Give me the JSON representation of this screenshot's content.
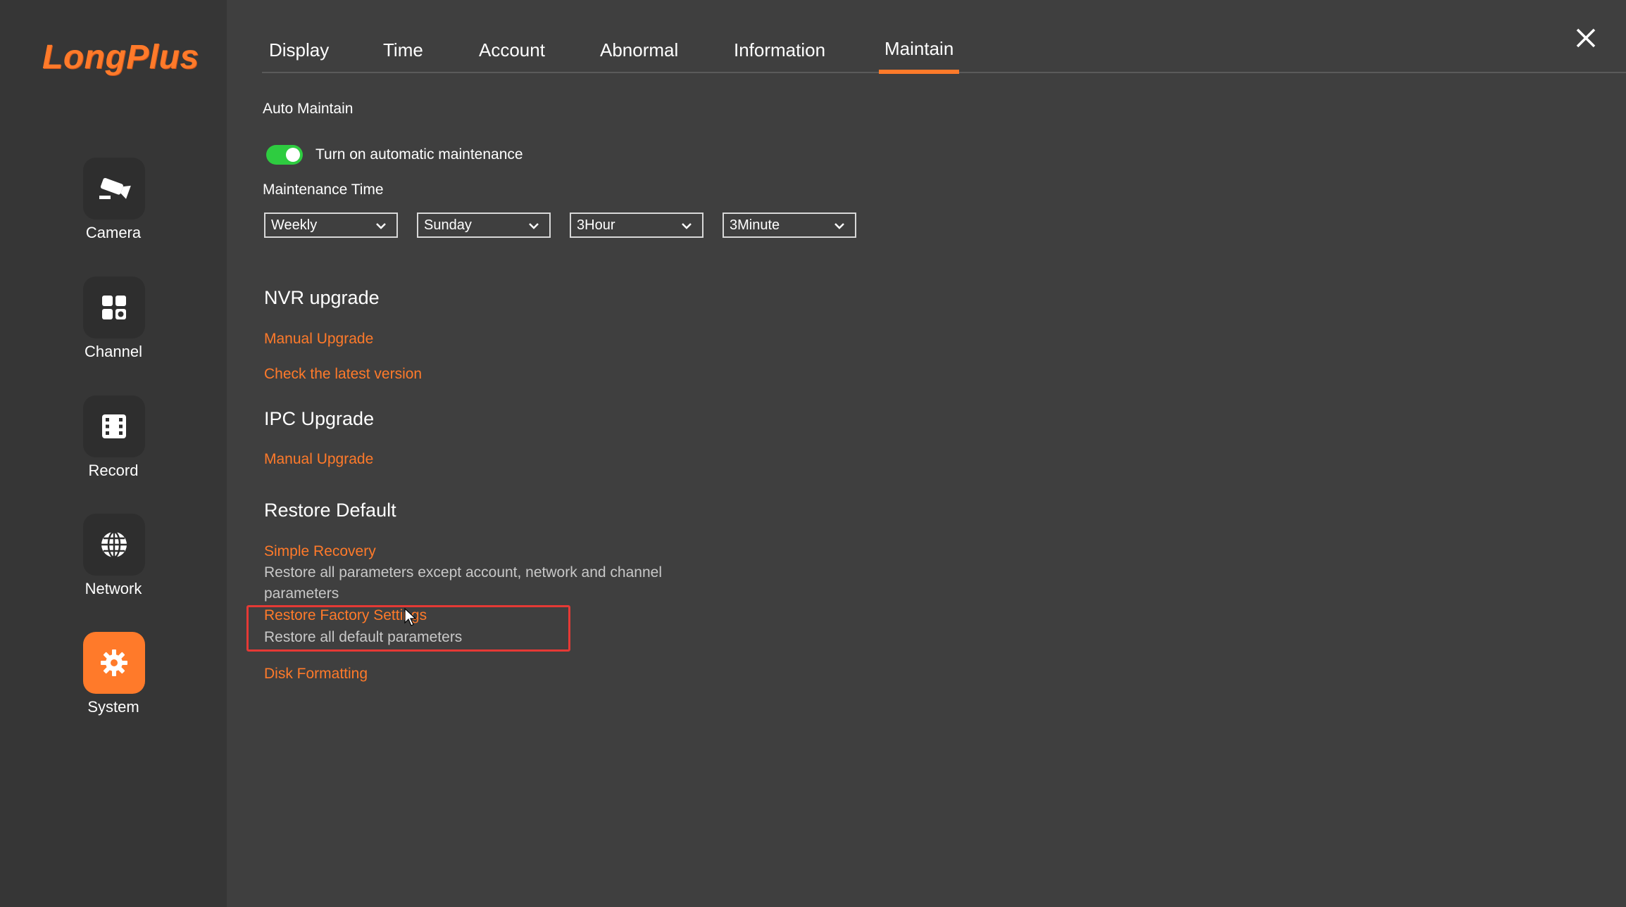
{
  "brand": {
    "name": "LongPlus",
    "color": "#ff7a2a"
  },
  "sidebar": {
    "items": [
      {
        "label": "Camera",
        "icon": "camera-icon",
        "active": false
      },
      {
        "label": "Channel",
        "icon": "channel-grid-icon",
        "active": false
      },
      {
        "label": "Record",
        "icon": "record-film-icon",
        "active": false
      },
      {
        "label": "Network",
        "icon": "globe-icon",
        "active": false
      },
      {
        "label": "System",
        "icon": "gear-icon",
        "active": true
      }
    ]
  },
  "tabs": [
    {
      "label": "Display"
    },
    {
      "label": "Time"
    },
    {
      "label": "Account"
    },
    {
      "label": "Abnormal"
    },
    {
      "label": "Information"
    },
    {
      "label": "Maintain",
      "active": true
    }
  ],
  "auto_maintain": {
    "heading": "Auto Maintain",
    "toggle_label": "Turn on automatic maintenance",
    "toggle_on": true,
    "time_label": "Maintenance Time",
    "selects": [
      {
        "value": "Weekly"
      },
      {
        "value": "Sunday"
      },
      {
        "value": "3Hour"
      },
      {
        "value": "3Minute"
      }
    ]
  },
  "nvr_upgrade": {
    "title": "NVR upgrade",
    "manual_upgrade": "Manual Upgrade",
    "check_latest": "Check the latest version"
  },
  "ipc_upgrade": {
    "title": "IPC Upgrade",
    "manual_upgrade": "Manual Upgrade"
  },
  "restore_default": {
    "title": "Restore Default",
    "simple_recovery": "Simple Recovery",
    "simple_recovery_desc": "Restore all parameters except account, network and channel parameters",
    "factory_settings": "Restore Factory Settings",
    "factory_settings_desc": "Restore all default parameters",
    "disk_formatting": "Disk Formatting"
  },
  "colors": {
    "accent": "#ff7a2a",
    "toggle_on": "#2ecc40",
    "highlight": "#e53935",
    "background": "#3f3f3f",
    "sidebar": "#363636"
  }
}
